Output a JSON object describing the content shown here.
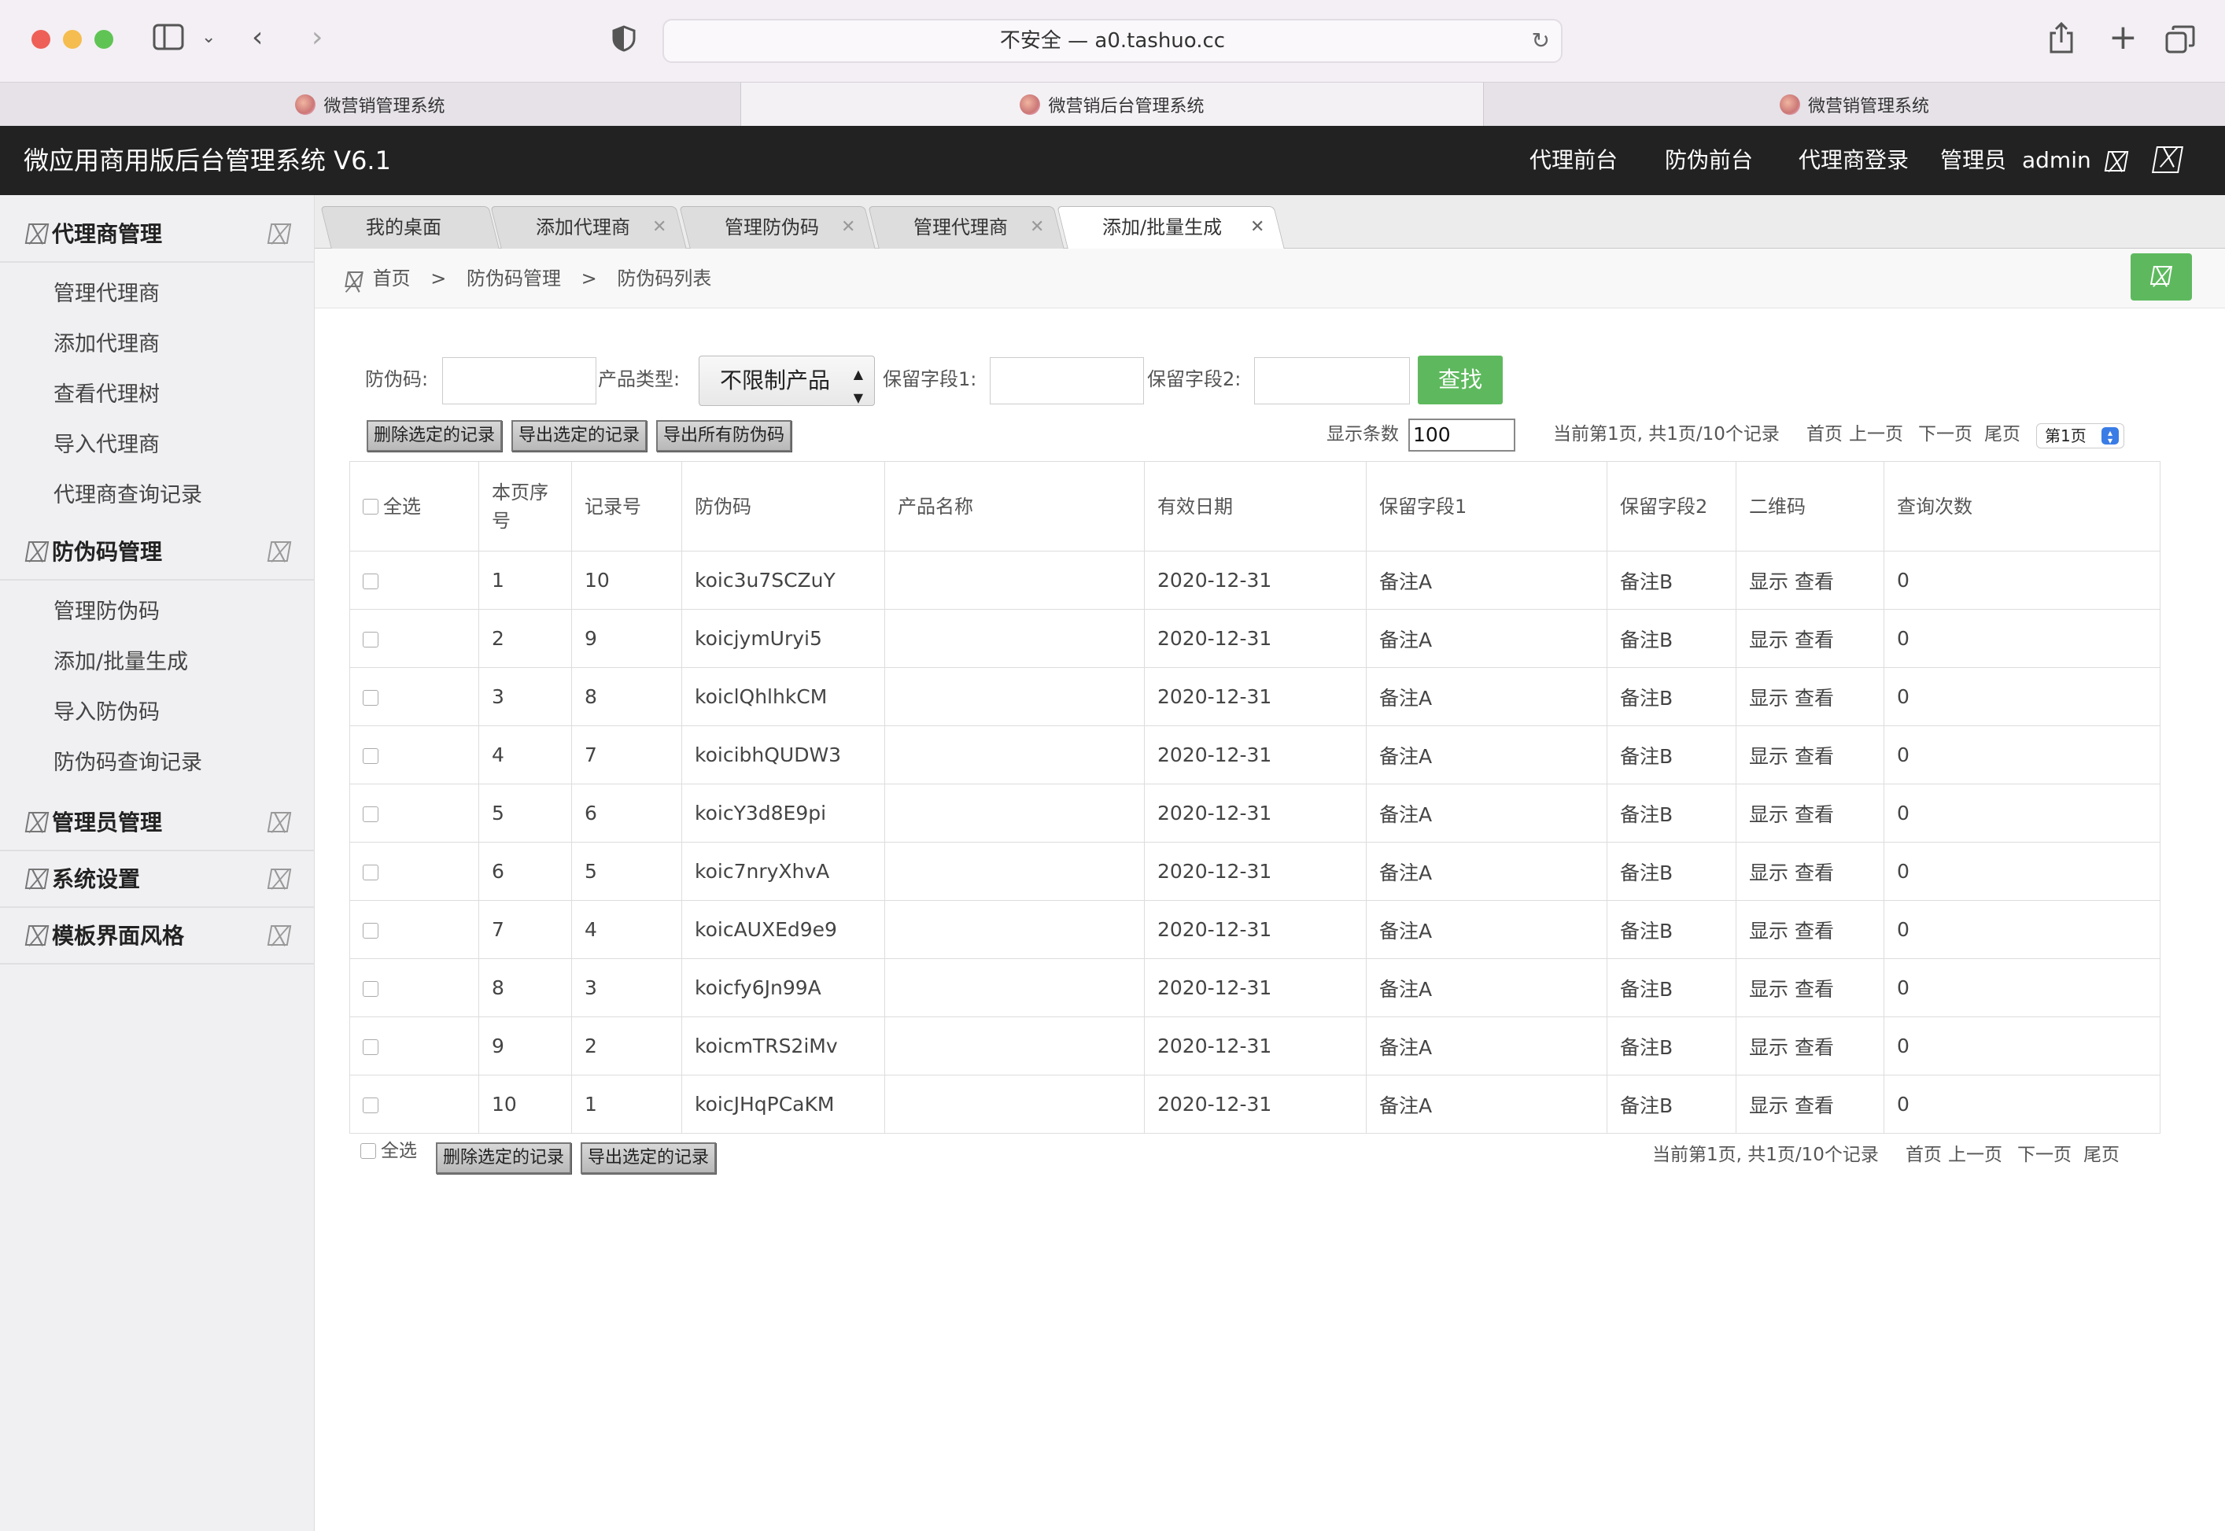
{
  "browser": {
    "address": "不安全 — a0.tashuo.cc",
    "tabs": [
      {
        "label": "微营销管理系统"
      },
      {
        "label": "微营销后台管理系统"
      },
      {
        "label": "微营销管理系统"
      }
    ]
  },
  "header": {
    "title": "微应用商用版后台管理系统 V6.1",
    "nav": [
      "代理前台",
      "防伪前台",
      "代理商登录"
    ],
    "role": "管理员",
    "user": "admin"
  },
  "sidebar": {
    "groups": [
      {
        "label": "代理商管理",
        "items": [
          "管理代理商",
          "添加代理商",
          "查看代理树",
          "导入代理商",
          "代理商查询记录"
        ]
      },
      {
        "label": "防伪码管理",
        "items": [
          "管理防伪码",
          "添加/批量生成",
          "导入防伪码",
          "防伪码查询记录"
        ]
      },
      {
        "label": "管理员管理",
        "items": []
      },
      {
        "label": "系统设置",
        "items": []
      },
      {
        "label": "模板界面风格",
        "items": []
      }
    ]
  },
  "content_tabs": [
    "我的桌面",
    "添加代理商",
    "管理防伪码",
    "管理代理商",
    "添加/批量生成"
  ],
  "breadcrumb": [
    "首页",
    "防伪码管理",
    "防伪码列表"
  ],
  "filters": {
    "code_label": "防伪码:",
    "code_value": "",
    "type_label": "产品类型:",
    "type_value": "不限制产品",
    "field1_label": "保留字段1:",
    "field1_value": "",
    "field2_label": "保留字段2:",
    "field2_value": "",
    "search_label": "查找"
  },
  "actions": {
    "delete_selected": "删除选定的记录",
    "export_selected": "导出选定的记录",
    "export_all": "导出所有防伪码"
  },
  "pagination": {
    "page_size_label": "显示条数",
    "page_size": "100",
    "summary": "当前第1页, 共1页/10个记录",
    "first": "首页",
    "prev": "上一页",
    "next": "下一页",
    "last": "尾页",
    "page_select": "第1页"
  },
  "table": {
    "select_all": "全选",
    "columns": [
      "本页序号",
      "记录号",
      "防伪码",
      "产品名称",
      "有效日期",
      "保留字段1",
      "保留字段2",
      "二维码",
      "查询次数"
    ],
    "row_actions": {
      "show": "显示",
      "view": "查看"
    },
    "rows": [
      {
        "seq": "1",
        "rec": "10",
        "code": "koic3u7SCZuY",
        "product": "",
        "date": "2020-12-31",
        "f1": "备注A",
        "f2": "备注B",
        "count": "0"
      },
      {
        "seq": "2",
        "rec": "9",
        "code": "koicjymUryi5",
        "product": "",
        "date": "2020-12-31",
        "f1": "备注A",
        "f2": "备注B",
        "count": "0"
      },
      {
        "seq": "3",
        "rec": "8",
        "code": "koiclQhlhkCM",
        "product": "",
        "date": "2020-12-31",
        "f1": "备注A",
        "f2": "备注B",
        "count": "0"
      },
      {
        "seq": "4",
        "rec": "7",
        "code": "koicibhQUDW3",
        "product": "",
        "date": "2020-12-31",
        "f1": "备注A",
        "f2": "备注B",
        "count": "0"
      },
      {
        "seq": "5",
        "rec": "6",
        "code": "koicY3d8E9pi",
        "product": "",
        "date": "2020-12-31",
        "f1": "备注A",
        "f2": "备注B",
        "count": "0"
      },
      {
        "seq": "6",
        "rec": "5",
        "code": "koic7nryXhvA",
        "product": "",
        "date": "2020-12-31",
        "f1": "备注A",
        "f2": "备注B",
        "count": "0"
      },
      {
        "seq": "7",
        "rec": "4",
        "code": "koicAUXEd9e9",
        "product": "",
        "date": "2020-12-31",
        "f1": "备注A",
        "f2": "备注B",
        "count": "0"
      },
      {
        "seq": "8",
        "rec": "3",
        "code": "koicfy6Jn99A",
        "product": "",
        "date": "2020-12-31",
        "f1": "备注A",
        "f2": "备注B",
        "count": "0"
      },
      {
        "seq": "9",
        "rec": "2",
        "code": "koicmTRS2iMv",
        "product": "",
        "date": "2020-12-31",
        "f1": "备注A",
        "f2": "备注B",
        "count": "0"
      },
      {
        "seq": "10",
        "rec": "1",
        "code": "koicJHqPCaKM",
        "product": "",
        "date": "2020-12-31",
        "f1": "备注A",
        "f2": "备注B",
        "count": "0"
      }
    ]
  },
  "footer_actions": {
    "select_all": "全选",
    "delete_selected": "删除选定的记录",
    "export_selected": "导出选定的记录"
  },
  "colors": {
    "accent_green": "#5eb95e",
    "header_bg": "#222222"
  }
}
